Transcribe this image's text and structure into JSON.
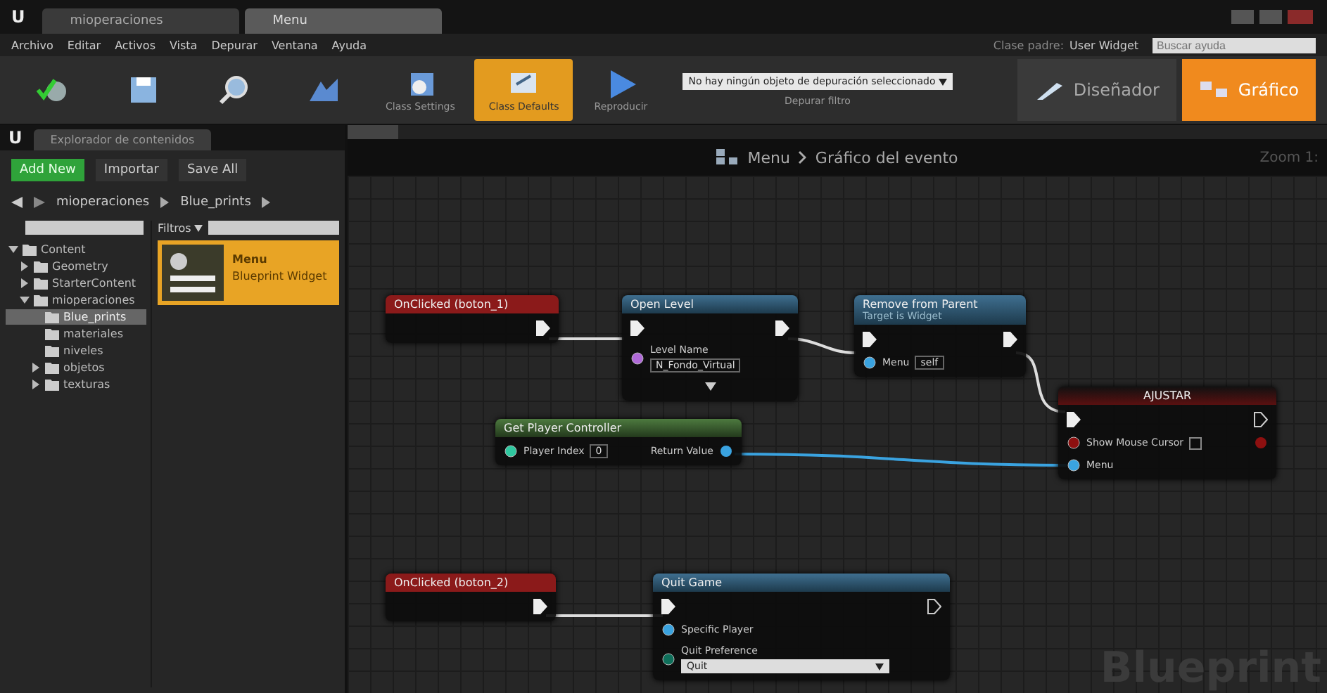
{
  "window": {
    "logo": "U",
    "tabs": [
      {
        "label": "mioperaciones",
        "selected": false
      },
      {
        "label": "Menu",
        "selected": true
      }
    ]
  },
  "menu_bar": {
    "items": [
      "Archivo",
      "Editar",
      "Activos",
      "Vista",
      "Depurar",
      "Ventana",
      "Ayuda"
    ],
    "parent_class_label": "Clase padre:",
    "parent_class": "User Widget",
    "search": {
      "placeholder": "Buscar ayuda"
    }
  },
  "toolbar": {
    "buttons": [
      {
        "kind": "compile",
        "selected": false
      },
      {
        "kind": "save",
        "selected": false
      },
      {
        "kind": "find",
        "selected": false
      },
      {
        "kind": "hide",
        "selected": false
      },
      {
        "kind": "settings",
        "label": "Class Settings",
        "selected": false
      },
      {
        "kind": "defaults",
        "label": "Class Defaults",
        "selected": true
      },
      {
        "kind": "play",
        "label": "Reproducir",
        "selected": false
      }
    ],
    "debug_filter": {
      "value": "No hay ningún objeto de depuración seleccionado",
      "label": "Depurar filtro"
    },
    "modes": [
      {
        "label": "Diseñador",
        "selected": false
      },
      {
        "label": "Gráfico",
        "selected": true
      }
    ]
  },
  "content_browser": {
    "logo": "U",
    "tab": "Explorador de contenidos",
    "actions": [
      {
        "kind": "add",
        "label": "Add New"
      },
      {
        "kind": "import",
        "label": "Importar"
      },
      {
        "kind": "save",
        "label": "Save All"
      }
    ],
    "path": [
      "mioperaciones",
      "Blue_prints"
    ],
    "filters": "Filtros",
    "tree": [
      {
        "label": "Content",
        "expanded": true,
        "selected": false,
        "children": [
          {
            "label": "Geometry",
            "expanded": false,
            "selected": false
          },
          {
            "label": "StarterContent",
            "expanded": false,
            "selected": false
          },
          {
            "label": "mioperaciones",
            "expanded": true,
            "selected": false,
            "children": [
              {
                "label": "Blue_prints",
                "selected": true
              },
              {
                "label": "materiales",
                "selected": false
              },
              {
                "label": "niveles",
                "selected": false
              },
              {
                "label": "objetos",
                "expanded": false,
                "selected": false
              },
              {
                "label": "texturas",
                "expanded": false,
                "selected": false
              }
            ]
          }
        ]
      }
    ],
    "assets": [
      {
        "name": "Menu",
        "type": "Blueprint Widget",
        "selected": true
      }
    ]
  },
  "graph": {
    "breadcrumb": [
      "Menu",
      "Gráfico del evento"
    ],
    "zoom": "Zoom 1:",
    "watermark": "Blueprint",
    "nodes": [
      {
        "kind": "event",
        "title": "OnClicked (boton_1)",
        "rows": [
          {
            "out_pin": {
              "kind": "exec"
            }
          }
        ]
      },
      {
        "kind": "function",
        "title": "Open Level",
        "rows": [
          {
            "in_pin": {
              "kind": "exec"
            },
            "out_pin": {
              "kind": "exec"
            }
          },
          {
            "in_pin": {
              "kind": "string"
            },
            "label": "Level Name",
            "value": "N_Fondo_Virtual"
          }
        ],
        "advanced": true
      },
      {
        "kind": "function",
        "title": "Remove from Parent",
        "subtitle": "Target is Widget",
        "rows": [
          {
            "in_pin": {
              "kind": "exec"
            },
            "out_pin": {
              "kind": "exec"
            }
          },
          {
            "in_pin": {
              "kind": "object"
            },
            "label": "Menu",
            "value": "self"
          }
        ]
      },
      {
        "kind": "pure",
        "title": "Get Player Controller",
        "rows": [
          {
            "in_pin": {
              "kind": "int"
            },
            "label": "Player Index",
            "value": "0",
            "out_pin": {
              "kind": "object"
            },
            "out_label": "Return Value"
          }
        ]
      },
      {
        "kind": "macro",
        "title": "AJUSTAR",
        "rows": [
          {
            "in_pin": {
              "kind": "exec"
            },
            "out_pin": {
              "kind": "exec_open"
            }
          },
          {
            "in_pin": {
              "kind": "bool"
            },
            "label": "Show Mouse Cursor",
            "checked": false,
            "out_pin": {
              "kind": "bool"
            }
          },
          {
            "in_pin": {
              "kind": "object"
            },
            "label": "Menu"
          }
        ]
      },
      {
        "kind": "event",
        "title": "OnClicked (boton_2)",
        "rows": [
          {
            "out_pin": {
              "kind": "exec"
            }
          }
        ]
      },
      {
        "kind": "function",
        "title": "Quit Game",
        "rows": [
          {
            "in_pin": {
              "kind": "exec"
            },
            "out_pin": {
              "kind": "exec_open"
            }
          },
          {
            "in_pin": {
              "kind": "object"
            },
            "label": "Specific Player"
          },
          {
            "in_pin": {
              "kind": "enum"
            },
            "label": "Quit Preference",
            "dropdown": "Quit"
          }
        ]
      }
    ]
  }
}
